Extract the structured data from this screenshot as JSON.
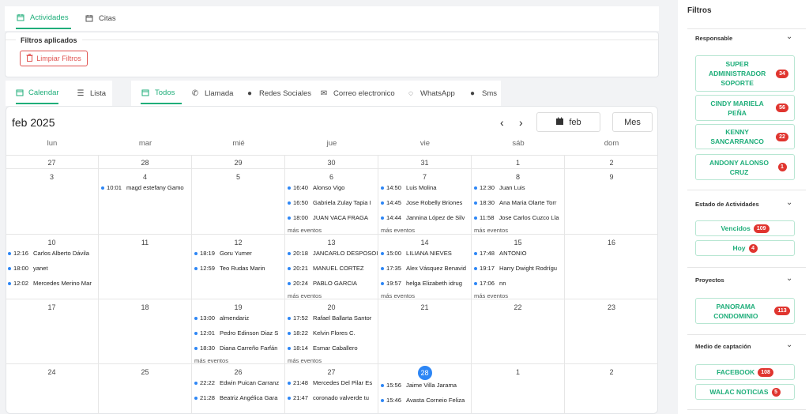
{
  "top_tabs": [
    {
      "label": "Actividades",
      "icon": "calendar-icon"
    },
    {
      "label": "Citas",
      "icon": "calendar-icon"
    }
  ],
  "filters": {
    "title": "Filtros aplicados",
    "clear_label": "Limpiar Filtros"
  },
  "view_tabs": [
    {
      "label": "Calendar",
      "icon": "calendar-icon"
    },
    {
      "label": "Lista",
      "icon": "list-icon"
    }
  ],
  "type_tabs": [
    {
      "label": "Todos",
      "icon": "calendar-icon"
    },
    {
      "label": "Llamada",
      "icon": "phone-icon"
    },
    {
      "label": "Redes Sociales",
      "icon": "chat-bubble-icon"
    },
    {
      "label": "Correo electronico",
      "icon": "mail-icon"
    },
    {
      "label": "WhatsApp",
      "icon": "whatsapp-icon"
    },
    {
      "label": "Sms",
      "icon": "sms-icon"
    }
  ],
  "calendar": {
    "title": "feb 2025",
    "month_button": "feb",
    "view_button": "Mes",
    "weekdays": [
      "lun",
      "mar",
      "mié",
      "jue",
      "vie",
      "sáb",
      "dom"
    ],
    "more_label": "más eventos",
    "weeks": [
      [
        {
          "d": "27",
          "ev": []
        },
        {
          "d": "28",
          "ev": []
        },
        {
          "d": "29",
          "ev": []
        },
        {
          "d": "30",
          "ev": []
        },
        {
          "d": "31",
          "ev": []
        },
        {
          "d": "1",
          "ev": []
        },
        {
          "d": "2",
          "ev": []
        }
      ],
      [
        {
          "d": "3",
          "ev": []
        },
        {
          "d": "4",
          "ev": [
            [
              "10:01",
              "magd estefany Gamo"
            ]
          ]
        },
        {
          "d": "5",
          "ev": []
        },
        {
          "d": "6",
          "ev": [
            [
              "16:40",
              "Alonso Vigo"
            ],
            [
              "16:50",
              "Gabriela Zulay Tapia I"
            ],
            [
              "18:00",
              "JUAN VACA FRAGA"
            ]
          ],
          "more": true
        },
        {
          "d": "7",
          "ev": [
            [
              "14:50",
              "Luis Molina"
            ],
            [
              "14:45",
              "Jose Robelly Briones"
            ],
            [
              "14:44",
              "Jannina López de Silv"
            ]
          ],
          "more": true
        },
        {
          "d": "8",
          "ev": [
            [
              "12:30",
              "Juan Luis"
            ],
            [
              "18:30",
              "Ana Maria Olarte Torr"
            ],
            [
              "11:58",
              "Jose Carlos Cuzco Lla"
            ]
          ],
          "more": true
        },
        {
          "d": "9",
          "ev": []
        }
      ],
      [
        {
          "d": "10",
          "ev": [
            [
              "12:16",
              "Carlos Alberto Dávila"
            ],
            [
              "18:00",
              "yanet"
            ],
            [
              "12:02",
              "Mercedes Merino Mar"
            ]
          ]
        },
        {
          "d": "11",
          "ev": []
        },
        {
          "d": "12",
          "ev": [
            [
              "18:19",
              "Goru Yumer"
            ],
            [
              "12:59",
              "Teo Rudas Marin"
            ]
          ]
        },
        {
          "d": "13",
          "ev": [
            [
              "20:18",
              "JANCARLO DESPOSOI"
            ],
            [
              "20:21",
              "MANUEL CORTEZ"
            ],
            [
              "20:24",
              "PABLO GARCIA"
            ]
          ],
          "more": true
        },
        {
          "d": "14",
          "ev": [
            [
              "15:00",
              "LILIANA NIEVES"
            ],
            [
              "17:35",
              "Alex Vásquez Benavid"
            ],
            [
              "19:57",
              "helga Elizabeth idrug"
            ]
          ],
          "more": true
        },
        {
          "d": "15",
          "ev": [
            [
              "17:48",
              "ANTONIO"
            ],
            [
              "19:17",
              "Harry Dwight Rodrígu"
            ],
            [
              "17:06",
              "nn"
            ]
          ],
          "more": true
        },
        {
          "d": "16",
          "ev": []
        }
      ],
      [
        {
          "d": "17",
          "ev": []
        },
        {
          "d": "18",
          "ev": []
        },
        {
          "d": "19",
          "ev": [
            [
              "13:00",
              "almendariz"
            ],
            [
              "12:01",
              "Pedro Edinson Diaz S"
            ],
            [
              "18:30",
              "Diana Carreño Farfán"
            ]
          ],
          "more": true
        },
        {
          "d": "20",
          "ev": [
            [
              "17:52",
              "Rafael Ballarta Santor"
            ],
            [
              "18:22",
              "Kelvin Flores C."
            ],
            [
              "18:14",
              "Esmar Caballero"
            ]
          ],
          "more": true
        },
        {
          "d": "21",
          "ev": []
        },
        {
          "d": "22",
          "ev": []
        },
        {
          "d": "23",
          "ev": []
        }
      ],
      [
        {
          "d": "24",
          "ev": []
        },
        {
          "d": "25",
          "ev": []
        },
        {
          "d": "26",
          "ev": [
            [
              "22:22",
              "Edwin Puican Carranz"
            ],
            [
              "21:28",
              "Beatriz Angélica Gara"
            ]
          ]
        },
        {
          "d": "27",
          "ev": [
            [
              "21:48",
              "Mercedes Del Pilar Es"
            ],
            [
              "21:47",
              "coronado valverde tu"
            ]
          ]
        },
        {
          "d": "28",
          "today": true,
          "ev": [
            [
              "15:56",
              "Jaime Villa Jarama"
            ],
            [
              "15:46",
              "Avasta Corneio Feliza"
            ]
          ]
        },
        {
          "d": "1",
          "ev": []
        },
        {
          "d": "2",
          "ev": []
        }
      ]
    ]
  },
  "sidebar": {
    "title": "Filtros",
    "sections": [
      {
        "title": "Responsable",
        "items": [
          {
            "label": "SUPER ADMINISTRADOR SOPORTE",
            "count": "34"
          },
          {
            "label": "CINDY MARIELA PEÑA",
            "count": "56"
          },
          {
            "label": "KENNY SANCARRANCO",
            "count": "22"
          },
          {
            "label": "ANDONY ALONSO CRUZ",
            "count": "1"
          }
        ]
      },
      {
        "title": "Estado de Actividades",
        "items": [
          {
            "label": "Vencidos",
            "count": "109"
          },
          {
            "label": "Hoy",
            "count": "4"
          }
        ]
      },
      {
        "title": "Proyectos",
        "items": [
          {
            "label": "PANORAMA CONDOMINIO",
            "count": "113"
          }
        ]
      },
      {
        "title": "Medio de captación",
        "items": [
          {
            "label": "FACEBOOK",
            "count": "108"
          },
          {
            "label": "WALAC NOTICIAS",
            "count": "5"
          }
        ]
      }
    ]
  },
  "colors": {
    "accent": "#1fae7a",
    "danger": "#e0352f",
    "event_dot": "#2d86f5"
  }
}
